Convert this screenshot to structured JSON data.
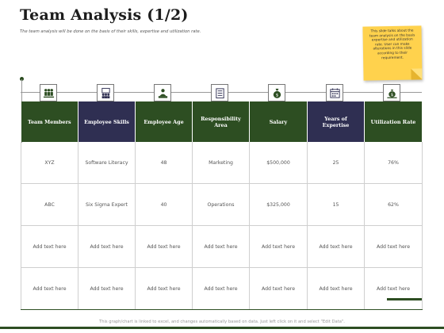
{
  "title": "Team Analysis (1/2)",
  "subtitle": "The team analysis will be done on the basis of their skills, expertise and utilization rate.",
  "note": "This slide talks about the team analysis on the basis expertise and utilization rate. User can make alterations in this slide according to their requirement.",
  "colors": {
    "green": "#2d4e22",
    "navy": "#2f2f52",
    "sticky": "#ffd24d"
  },
  "icons": [
    "team-icon",
    "training-icon",
    "worker-icon",
    "checklist-icon",
    "money-bag-icon",
    "calendar-icon",
    "money-growth-icon"
  ],
  "headers": [
    "Team Members",
    "Employee Skills",
    "Employee Age",
    "Responsibility Area",
    "Salary",
    "Years of Expertise",
    "Utilization Rate"
  ],
  "rows": [
    [
      "XYZ",
      "Software Literacy",
      "48",
      "Marketing",
      "$500,000",
      "25",
      "76%"
    ],
    [
      "ABC",
      "Six Sigma Expert",
      "40",
      "Operations",
      "$325,000",
      "15",
      "62%"
    ],
    [
      "Add text here",
      "Add text here",
      "Add text here",
      "Add text here",
      "Add text here",
      "Add text here",
      "Add text here"
    ],
    [
      "Add text here",
      "Add text here",
      "Add text here",
      "Add text here",
      "Add text here",
      "Add text here",
      "Add text here"
    ]
  ],
  "footer": "This graph/chart is linked to excel, and changes automatically based on data. Just left click on it and select \"Edit Data\"."
}
